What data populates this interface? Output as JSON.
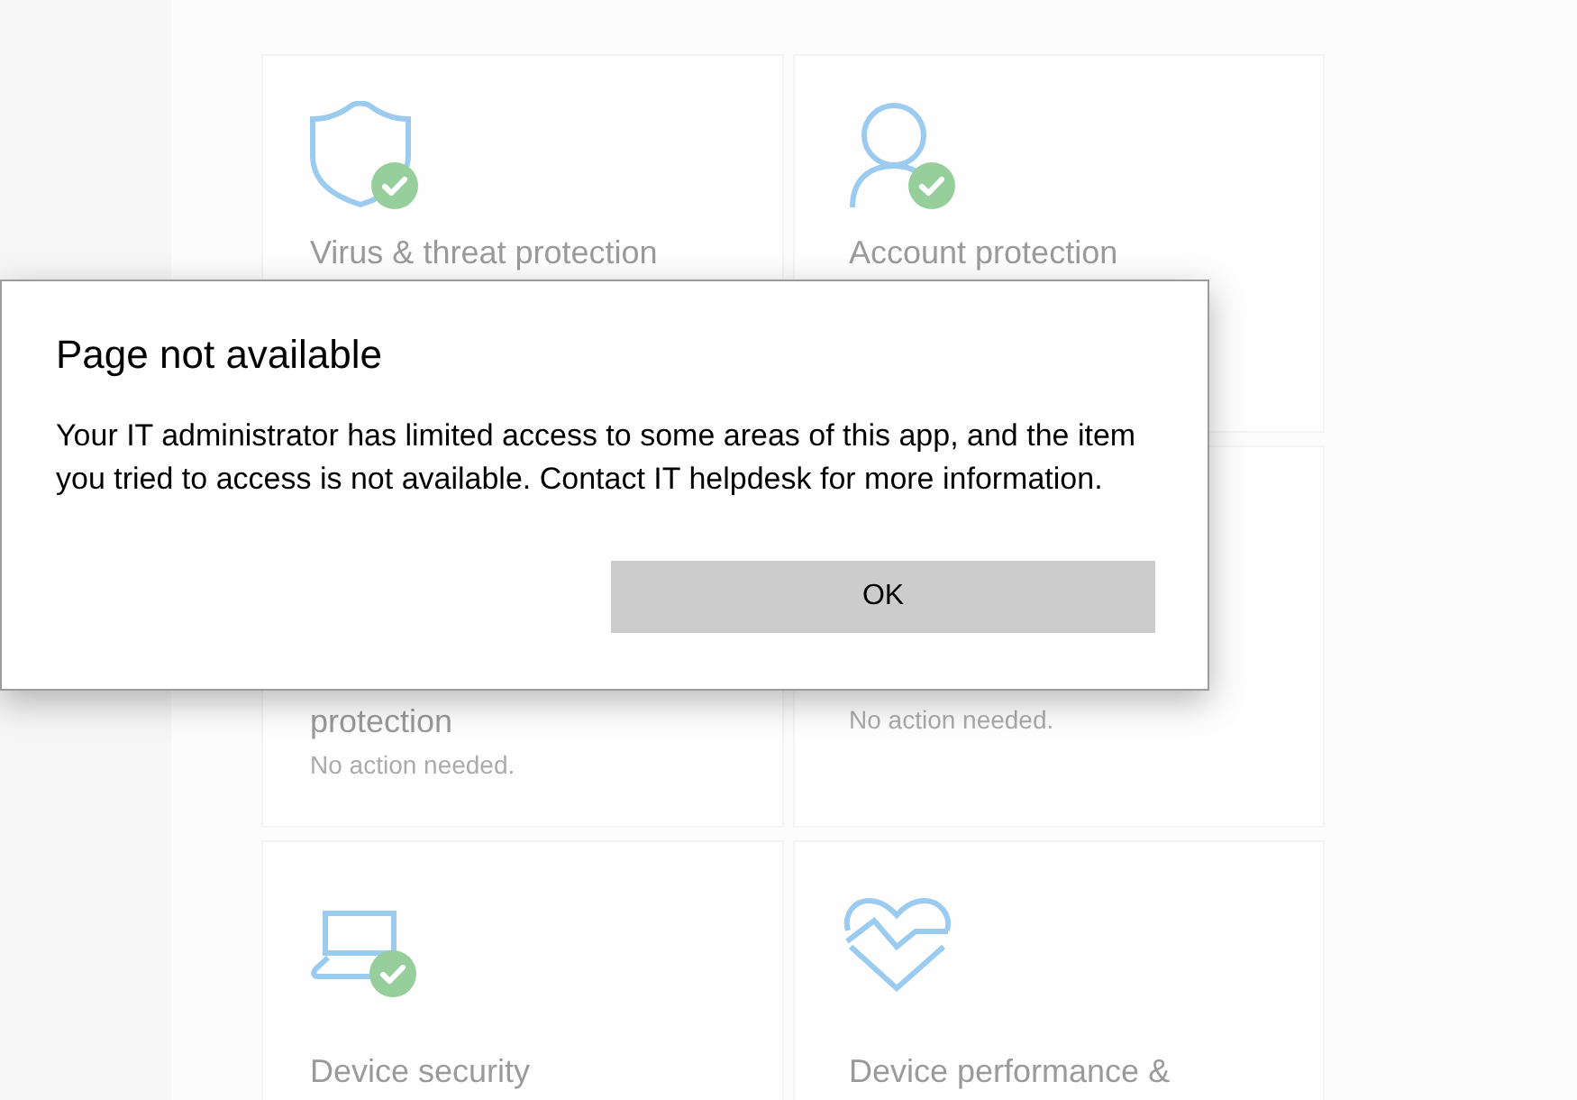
{
  "tiles": [
    {
      "title": "Virus & threat protection",
      "healthy": true
    },
    {
      "title": "Account protection",
      "healthy": true
    },
    {
      "title": "protection",
      "subtitle": "No action needed."
    },
    {
      "subtitle": "No action needed."
    },
    {
      "title": "Device security",
      "healthy": true
    },
    {
      "title": "Device performance &",
      "healthy": false
    }
  ],
  "dialog": {
    "title": "Page not available",
    "message": "Your IT administrator has limited access to some areas of this app, and the item you tried to access is not available. Contact IT helpdesk for more information.",
    "buttons": [
      {
        "label": "OK"
      }
    ]
  }
}
